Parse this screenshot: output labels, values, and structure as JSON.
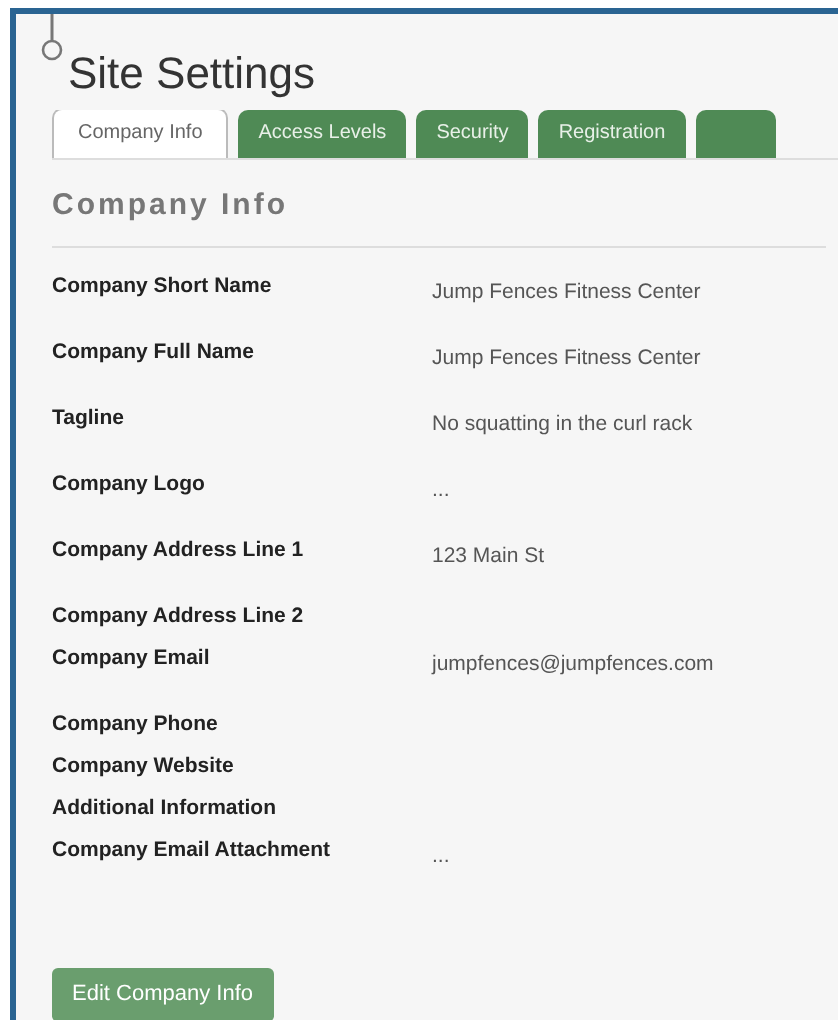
{
  "page": {
    "title": "Site Settings"
  },
  "tabs": [
    {
      "label": "Company Info",
      "selected": true
    },
    {
      "label": "Access Levels",
      "selected": false
    },
    {
      "label": "Security",
      "selected": false
    },
    {
      "label": "Registration",
      "selected": false
    },
    {
      "selected": false
    }
  ],
  "section": {
    "heading": "Company Info"
  },
  "fields": [
    {
      "label": "Company Short Name",
      "value": "Jump Fences Fitness Center"
    },
    {
      "label": "Company Full Name",
      "value": "Jump Fences Fitness Center"
    },
    {
      "label": "Tagline",
      "value": "No squatting in the curl rack"
    },
    {
      "label": "Company Logo",
      "value": "..."
    },
    {
      "label": "Company Address Line 1",
      "value": "123 Main St"
    },
    {
      "label": "Company Address Line 2"
    },
    {
      "label": "Company Email",
      "value": "jumpfences@jumpfences.com"
    },
    {
      "label": "Company Phone"
    },
    {
      "label": "Company Website"
    },
    {
      "label": "Additional Information"
    },
    {
      "label": "Company Email Attachment",
      "value": "..."
    }
  ],
  "button": {
    "label": "Edit Company Info"
  }
}
